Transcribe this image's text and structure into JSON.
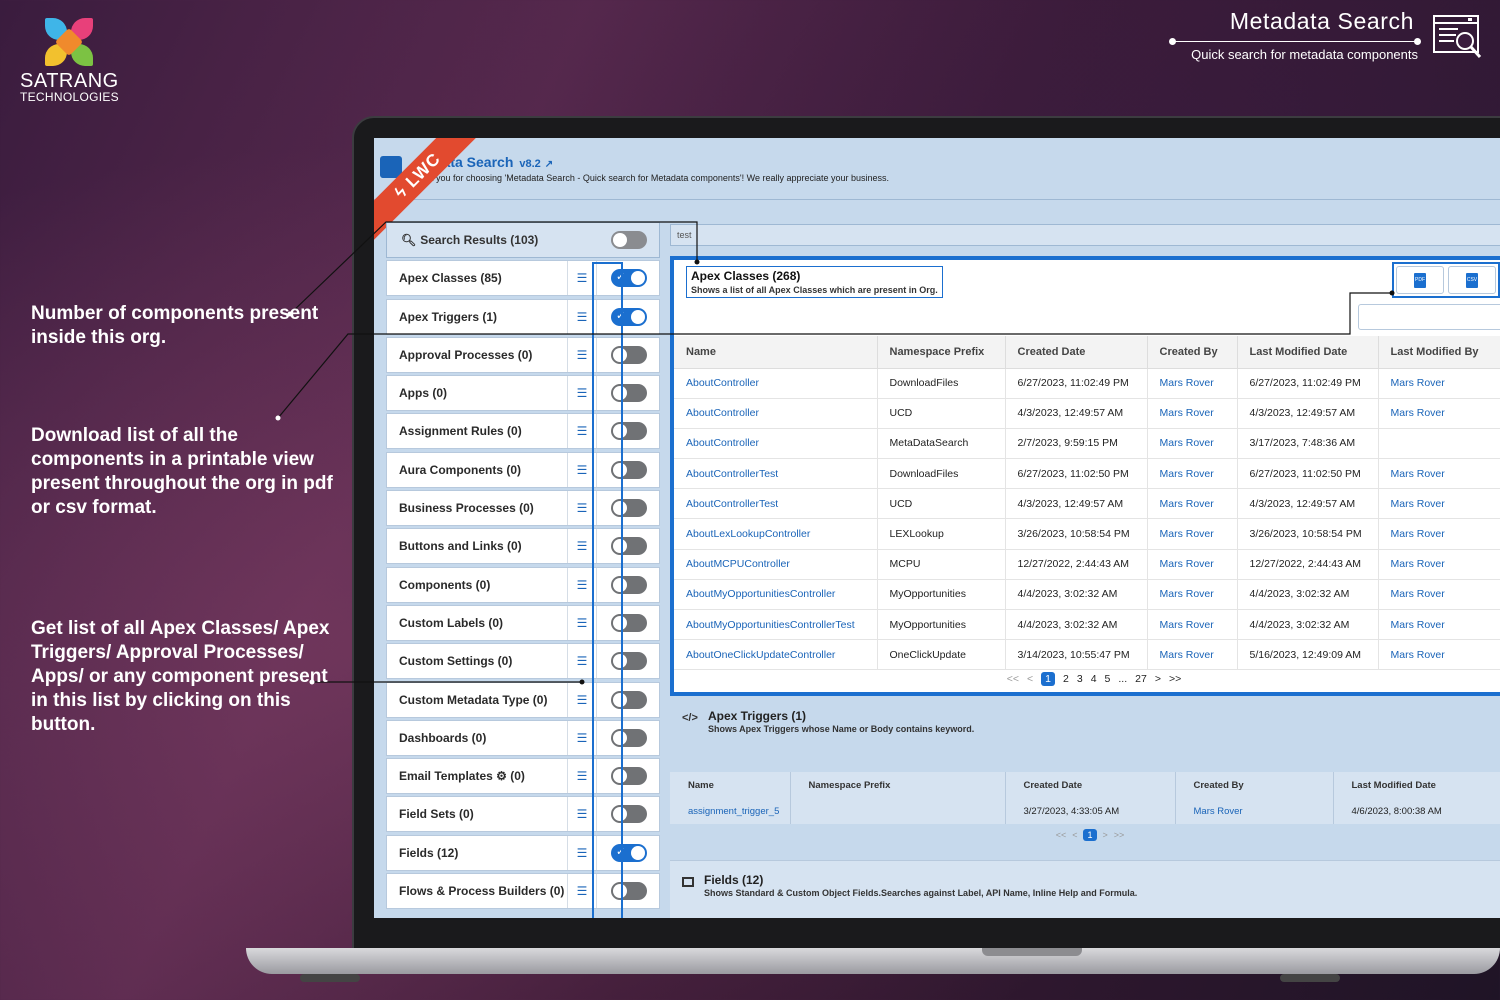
{
  "brand": {
    "name": "SATRANG",
    "subname": "TECHNOLOGIES"
  },
  "header": {
    "title": "Metadata Search",
    "subtitle": "Quick search for metadata components"
  },
  "app": {
    "title": "Metadata Search",
    "title_visible": "data Search",
    "version": "v8.2",
    "subtitle": "hank you for choosing 'Metadata Search - Quick search for Metadata components'! We really appreciate your business.",
    "badge": "LWC"
  },
  "sidebar": {
    "search_results": "Search Results (103)",
    "items": [
      {
        "label": "Apex Classes (85)",
        "on": true
      },
      {
        "label": "Apex Triggers (1)",
        "on": true
      },
      {
        "label": "Approval Processes (0)",
        "on": false
      },
      {
        "label": "Apps (0)",
        "on": false
      },
      {
        "label": "Assignment Rules (0)",
        "on": false
      },
      {
        "label": "Aura Components (0)",
        "on": false
      },
      {
        "label": "Business Processes (0)",
        "on": false
      },
      {
        "label": "Buttons and Links (0)",
        "on": false
      },
      {
        "label": "Components (0)",
        "on": false
      },
      {
        "label": "Custom Labels (0)",
        "on": false
      },
      {
        "label": "Custom Settings (0)",
        "on": false
      },
      {
        "label": "Custom Metadata Type (0)",
        "on": false
      },
      {
        "label": "Dashboards (0)",
        "on": false
      },
      {
        "label": "Email Templates ⚙ (0)",
        "on": false
      },
      {
        "label": "Field Sets (0)",
        "on": false
      },
      {
        "label": "Fields (12)",
        "on": true
      },
      {
        "label": "Flows & Process Builders (0)",
        "on": false
      }
    ]
  },
  "search_input": {
    "value": "test"
  },
  "apex_classes": {
    "title": "Apex Classes (268)",
    "description": "Shows a list of all Apex Classes which are present in Org.",
    "download": {
      "pdf": "PDF",
      "csv": "CSV"
    },
    "columns": [
      "Name",
      "Namespace Prefix",
      "Created Date",
      "Created By",
      "Last Modified Date",
      "Last Modified By"
    ],
    "rows": [
      [
        "AboutController",
        "DownloadFiles",
        "6/27/2023, 11:02:49 PM",
        "Mars Rover",
        "6/27/2023, 11:02:49 PM",
        "Mars Rover"
      ],
      [
        "AboutController",
        "UCD",
        "4/3/2023, 12:49:57 AM",
        "Mars Rover",
        "4/3/2023, 12:49:57 AM",
        "Mars Rover"
      ],
      [
        "AboutController",
        "MetaDataSearch",
        "2/7/2023, 9:59:15 PM",
        "Mars Rover",
        "3/17/2023, 7:48:36 AM",
        ""
      ],
      [
        "AboutControllerTest",
        "DownloadFiles",
        "6/27/2023, 11:02:50 PM",
        "Mars Rover",
        "6/27/2023, 11:02:50 PM",
        "Mars Rover"
      ],
      [
        "AboutControllerTest",
        "UCD",
        "4/3/2023, 12:49:57 AM",
        "Mars Rover",
        "4/3/2023, 12:49:57 AM",
        "Mars Rover"
      ],
      [
        "AboutLexLookupController",
        "LEXLookup",
        "3/26/2023, 10:58:54 PM",
        "Mars Rover",
        "3/26/2023, 10:58:54 PM",
        "Mars Rover"
      ],
      [
        "AboutMCPUController",
        "MCPU",
        "12/27/2022, 2:44:43 AM",
        "Mars Rover",
        "12/27/2022, 2:44:43 AM",
        "Mars Rover"
      ],
      [
        "AboutMyOpportunitiesController",
        "MyOpportunities",
        "4/4/2023, 3:02:32 AM",
        "Mars Rover",
        "4/4/2023, 3:02:32 AM",
        "Mars Rover"
      ],
      [
        "AboutMyOpportunitiesControllerTest",
        "MyOpportunities",
        "4/4/2023, 3:02:32 AM",
        "Mars Rover",
        "4/4/2023, 3:02:32 AM",
        "Mars Rover"
      ],
      [
        "AboutOneClickUpdateController",
        "OneClickUpdate",
        "3/14/2023, 10:55:47 PM",
        "Mars Rover",
        "5/16/2023, 12:49:09 AM",
        "Mars Rover"
      ]
    ],
    "pagination": [
      "<<",
      "<",
      "1",
      "2",
      "3",
      "4",
      "5",
      "...",
      "27",
      ">",
      ">>"
    ]
  },
  "apex_triggers": {
    "icon": "</>",
    "title": "Apex Triggers (1)",
    "description": "Shows Apex Triggers whose Name or Body contains keyword.",
    "columns": [
      "Name",
      "Namespace Prefix",
      "Created Date",
      "Created By",
      "Last Modified Date"
    ],
    "rows": [
      [
        "assignment_trigger_5",
        "",
        "3/27/2023, 4:33:05 AM",
        "Mars Rover",
        "4/6/2023, 8:00:38 AM"
      ]
    ],
    "pagination": [
      "<<",
      "<",
      "1",
      ">",
      ">>"
    ]
  },
  "fields_section": {
    "title": "Fields (12)",
    "description": "Shows Standard & Custom Object Fields.Searches against Label, API Name, Inline Help and Formula."
  },
  "annotations": {
    "a1": "Number of components present inside this org.",
    "a2": "Download list of all the components in a printable view present throughout the org in pdf or csv format.",
    "a3": "Get list of all Apex Classes/ Apex Triggers/ Approval Processes/ Apps/ or any component present in this list by clicking on this button."
  },
  "colors": {
    "accent": "#1b6fcf",
    "badge": "#e24a2f",
    "background": "#3a1c3e"
  }
}
